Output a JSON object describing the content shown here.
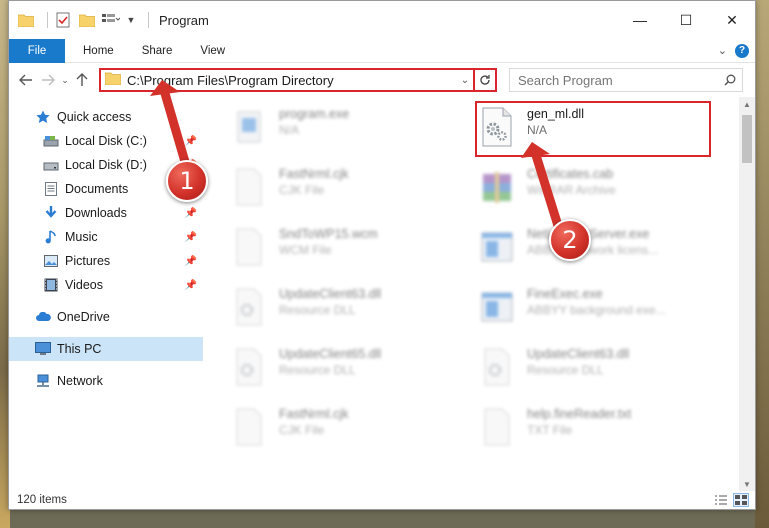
{
  "window": {
    "title": "Program",
    "controls": {
      "minimize": "—",
      "maximize": "☐",
      "close": "✕"
    }
  },
  "ribbon": {
    "tabs": [
      {
        "label": "File"
      },
      {
        "label": "Home"
      },
      {
        "label": "Share"
      },
      {
        "label": "View"
      }
    ]
  },
  "address": {
    "path": "C:\\Program Files\\Program Directory",
    "search_placeholder": "Search Program"
  },
  "navpane": {
    "quick_access": "Quick access",
    "items": [
      {
        "label": "Local Disk (C:)",
        "icon": "drive-icon",
        "pinned": true
      },
      {
        "label": "Local Disk (D:)",
        "icon": "drive-icon",
        "pinned": true
      },
      {
        "label": "Documents",
        "icon": "documents-icon",
        "pinned": true
      },
      {
        "label": "Downloads",
        "icon": "downloads-icon",
        "pinned": true
      },
      {
        "label": "Music",
        "icon": "music-icon",
        "pinned": true
      },
      {
        "label": "Pictures",
        "icon": "pictures-icon",
        "pinned": true
      },
      {
        "label": "Videos",
        "icon": "videos-icon",
        "pinned": true
      }
    ],
    "onedrive": "OneDrive",
    "this_pc": "This PC",
    "network": "Network"
  },
  "files": [
    {
      "name": "program.exe",
      "type": "N/A",
      "icon": "exe-icon",
      "blurred": true
    },
    {
      "name": "gen_ml.dll",
      "type": "N/A",
      "icon": "dll-gear-icon",
      "blurred": false,
      "highlighted": true
    },
    {
      "name": "FastNrml.cjk",
      "type": "CJK File",
      "icon": "blank-file-icon",
      "blurred": true
    },
    {
      "name": "Certificates.cab",
      "type": "WinRAR Archive",
      "icon": "winrar-icon",
      "blurred": true
    },
    {
      "name": "SndToWP15.wcm",
      "type": "WCM File",
      "icon": "blank-file-icon",
      "blurred": true
    },
    {
      "name": "NetLicenseServer.exe",
      "type": "ABBYY Network licens...",
      "icon": "app-window-icon",
      "blurred": true
    },
    {
      "name": "UpdateClient63.dll",
      "type": "Resource DLL",
      "icon": "dll-gear-icon",
      "blurred": true
    },
    {
      "name": "FineExec.exe",
      "type": "ABBYY background exe...",
      "icon": "app-window-icon",
      "blurred": true
    },
    {
      "name": "UpdateClient65.dll",
      "type": "Resource DLL",
      "icon": "dll-gear-icon",
      "blurred": true
    },
    {
      "name": "UpdateClient63.dll",
      "type": "Resource DLL",
      "icon": "dll-gear-icon",
      "blurred": true
    },
    {
      "name": "FastNrml.cjk",
      "type": "CJK File",
      "icon": "blank-file-icon",
      "blurred": true
    },
    {
      "name": "help.fineReader.txt",
      "type": "TXT File",
      "icon": "blank-file-icon",
      "blurred": true
    }
  ],
  "status": {
    "item_count": "120 items"
  },
  "callouts": {
    "badge1": "1",
    "badge2": "2"
  },
  "colors": {
    "accent_blue": "#1979ca",
    "highlight_red": "#d9262c",
    "selected_nav": "#cce4f7"
  }
}
